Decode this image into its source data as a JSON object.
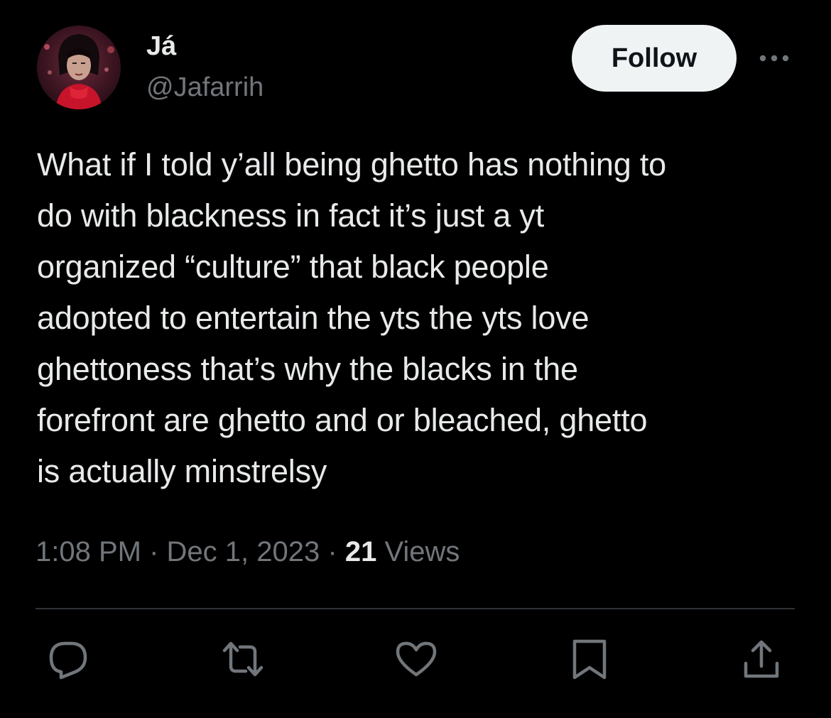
{
  "author": {
    "display_name": "Já",
    "handle": "@Jafarrih"
  },
  "follow_button": {
    "label": "Follow"
  },
  "tweet": {
    "text": "What if I told y’all being ghetto has nothing to\ndo with blackness in fact it’s just a yt\norganized “culture” that black people\nadopted to entertain the yts the yts love\nghettoness that’s why the blacks in the\nforefront are ghetto and or bleached, ghetto\nis actually minstrelsy"
  },
  "meta": {
    "time": "1:08 PM",
    "separator": "·",
    "date": "Dec 1, 2023",
    "views_count": "21",
    "views_label": "Views"
  },
  "actions": [
    {
      "icon": "reply-icon"
    },
    {
      "icon": "retweet-icon"
    },
    {
      "icon": "like-icon"
    },
    {
      "icon": "bookmark-icon"
    },
    {
      "icon": "share-icon"
    }
  ],
  "colors": {
    "background": "#000000",
    "primary_text": "#e7e9ea",
    "secondary_text": "#71767b",
    "divider": "#2f3336",
    "follow_bg": "#eff3f4"
  }
}
